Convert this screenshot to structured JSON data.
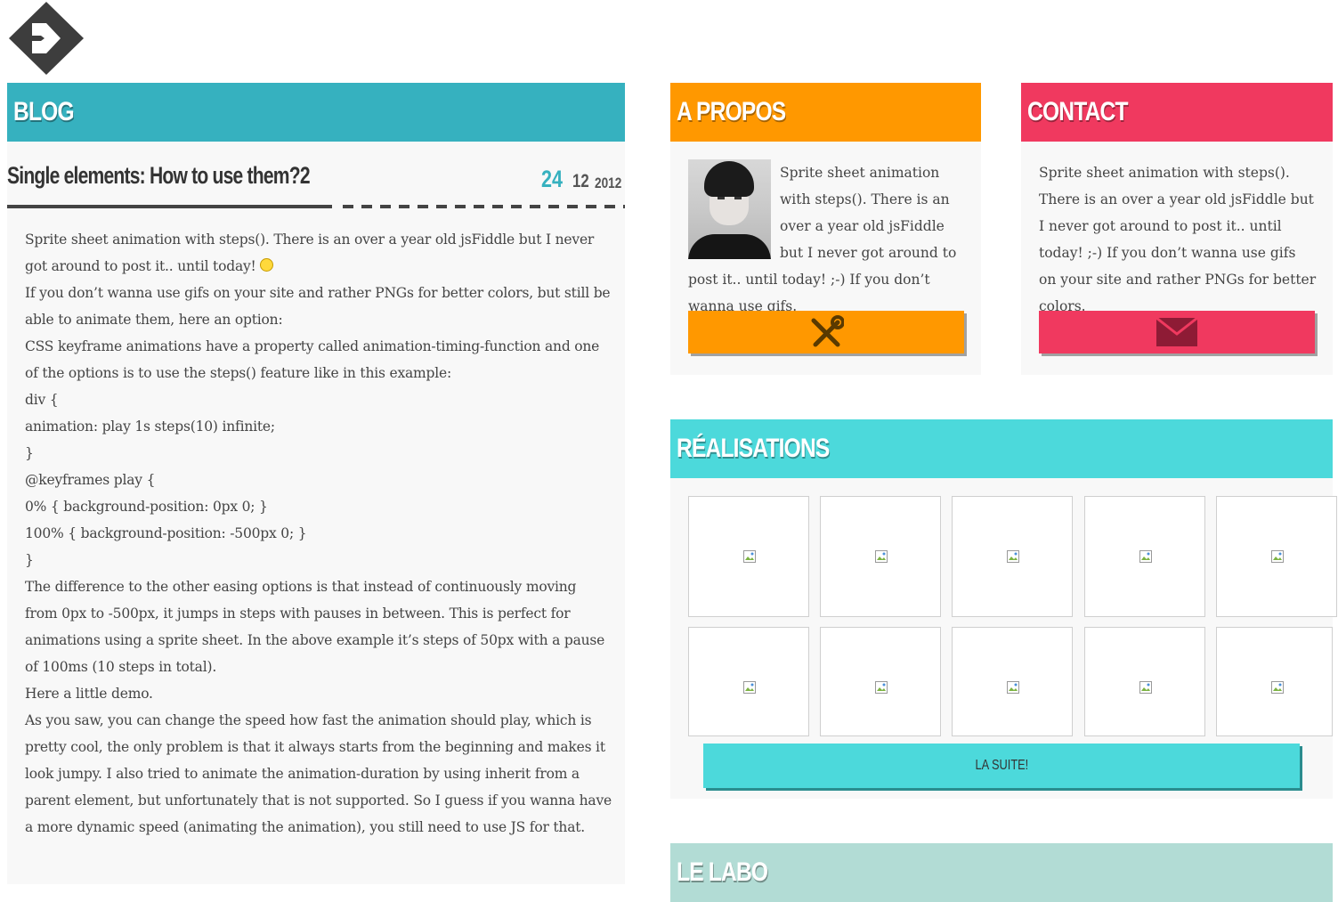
{
  "logo": {
    "icon": "diamond-arrow-logo",
    "color": "#3d3d3d"
  },
  "blog": {
    "header": "Blog",
    "header_color": "#36b1bf",
    "post": {
      "title": "Single elements: How to use them?2",
      "date": {
        "day": "24",
        "month": "12",
        "year": "2012"
      },
      "paragraphs": [
        "Sprite sheet animation with steps(). There is an over a year old jsFiddle but I never got around to post it.. until today!",
        "If you don’t wanna use gifs on your site and rather PNGs for better colors, but still be able to animate them, here an option:",
        "CSS keyframe animations have a property called animation-timing-function and one of the options is to use the steps() feature like in this example:",
        "div {",
        "animation: play 1s steps(10) infinite;",
        "}",
        "@keyframes play {",
        "0% { background-position: 0px 0; }",
        "100% { background-position: -500px 0; }",
        "}",
        "The difference to the other easing options is that instead of continuously moving from 0px to -500px, it jumps in steps with pauses in between. This is perfect for animations using a sprite sheet. In the above example it’s steps of 50px with a pause of 100ms (10 steps in total).",
        "Here a little demo.",
        "As you saw, you can change the speed how fast the animation should play, which is pretty cool, the only problem is that it always starts from the beginning and makes it look jumpy. I also tried to animate the animation-duration by using inherit from a parent element, but unfortunately that is not supported. So I guess if you wanna have a more dynamic speed (animating the animation), you still need to use JS for that."
      ]
    }
  },
  "apropos": {
    "header": "A propos",
    "header_color": "#ff9800",
    "text": "Sprite sheet animation with steps(). There is an over a year old jsFiddle but I never got around to post it.. until today! ;-) If you don’t wanna use gifs.",
    "button_icon": "tools-icon"
  },
  "contact": {
    "header": "Contact",
    "header_color": "#f0395f",
    "text": "Sprite sheet animation with steps(). There is an over a year old jsFiddle but I never got around to post it.. until today! ;-) If you don’t wanna use gifs on your site and rather PNGs for better colors.",
    "button_icon": "envelope-icon"
  },
  "realisations": {
    "header": "Réalisations",
    "header_color": "#4cd9db",
    "thumbnails_count": 10,
    "more_button": "La suite!"
  },
  "labo": {
    "header": "Le labo",
    "header_color": "#b2dcd5"
  }
}
